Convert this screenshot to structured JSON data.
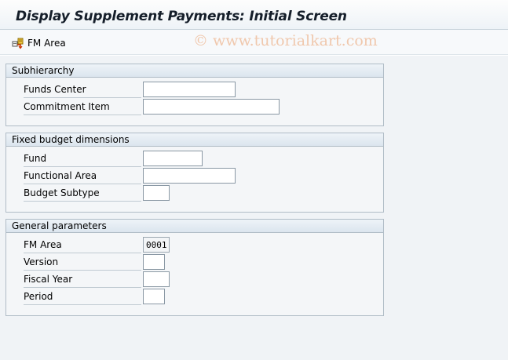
{
  "title": "Display Supplement Payments: Initial Screen",
  "toolbar": {
    "fm_area_label": "FM Area",
    "fm_area_icon": "fm-area-icon"
  },
  "watermark": "© www.tutorialkart.com",
  "groups": {
    "subhierarchy": {
      "title": "Subhierarchy",
      "fields": [
        {
          "label": "Funds Center",
          "value": ""
        },
        {
          "label": "Commitment Item",
          "value": ""
        }
      ]
    },
    "fixed_budget": {
      "title": "Fixed budget dimensions",
      "fields": [
        {
          "label": "Fund",
          "value": ""
        },
        {
          "label": "Functional Area",
          "value": ""
        },
        {
          "label": "Budget Subtype",
          "value": ""
        }
      ]
    },
    "general": {
      "title": "General parameters",
      "fields": [
        {
          "label": "FM Area",
          "value": "0001"
        },
        {
          "label": "Version",
          "value": ""
        },
        {
          "label": "Fiscal Year",
          "value": ""
        },
        {
          "label": "Period",
          "value": ""
        }
      ]
    }
  },
  "colors": {
    "title_text": "#151e2a",
    "work_background": "#f0f3f6",
    "group_border": "#b0bcc6",
    "watermark": "#f0c8ad"
  }
}
